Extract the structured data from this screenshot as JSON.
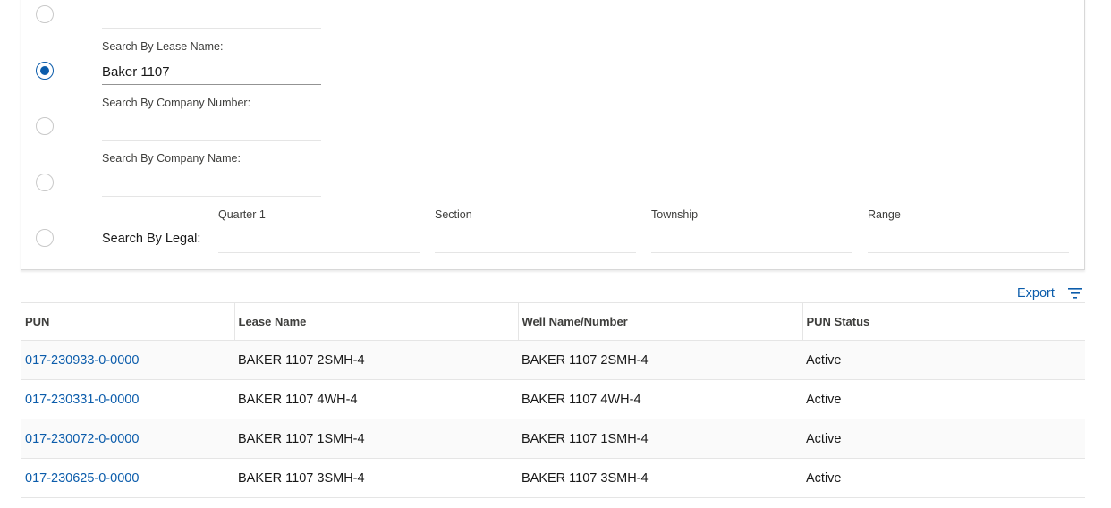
{
  "search_panel": {
    "options": [
      {
        "label": "",
        "value": "",
        "checked": false
      },
      {
        "label": "Search By Lease Name:",
        "value": "Baker 1107",
        "checked": true
      },
      {
        "label": "Search By Company Number:",
        "value": "",
        "checked": false
      },
      {
        "label": "Search By Company Name:",
        "value": "",
        "checked": false
      }
    ],
    "legal": {
      "label": "Search By Legal:",
      "checked": false,
      "fields": [
        {
          "label": "Quarter 1",
          "value": ""
        },
        {
          "label": "Section",
          "value": ""
        },
        {
          "label": "Township",
          "value": ""
        },
        {
          "label": "Range",
          "value": ""
        }
      ]
    }
  },
  "toolbar": {
    "export_label": "Export",
    "filter_icon": "filter-icon"
  },
  "table": {
    "columns": [
      "PUN",
      "Lease Name",
      "Well Name/Number",
      "PUN Status"
    ],
    "rows": [
      {
        "pun": "017-230933-0-0000",
        "lease_name": "BAKER 1107 2SMH-4",
        "well_name": "BAKER 1107 2SMH-4",
        "status": "Active"
      },
      {
        "pun": "017-230331-0-0000",
        "lease_name": "BAKER 1107 4WH-4",
        "well_name": "BAKER 1107 4WH-4",
        "status": "Active"
      },
      {
        "pun": "017-230072-0-0000",
        "lease_name": "BAKER 1107 1SMH-4",
        "well_name": "BAKER 1107 1SMH-4",
        "status": "Active"
      },
      {
        "pun": "017-230625-0-0000",
        "lease_name": "BAKER 1107 3SMH-4",
        "well_name": "BAKER 1107 3SMH-4",
        "status": "Active"
      }
    ]
  },
  "colors": {
    "accent": "#0b5cab",
    "border": "#e5e5e5"
  }
}
